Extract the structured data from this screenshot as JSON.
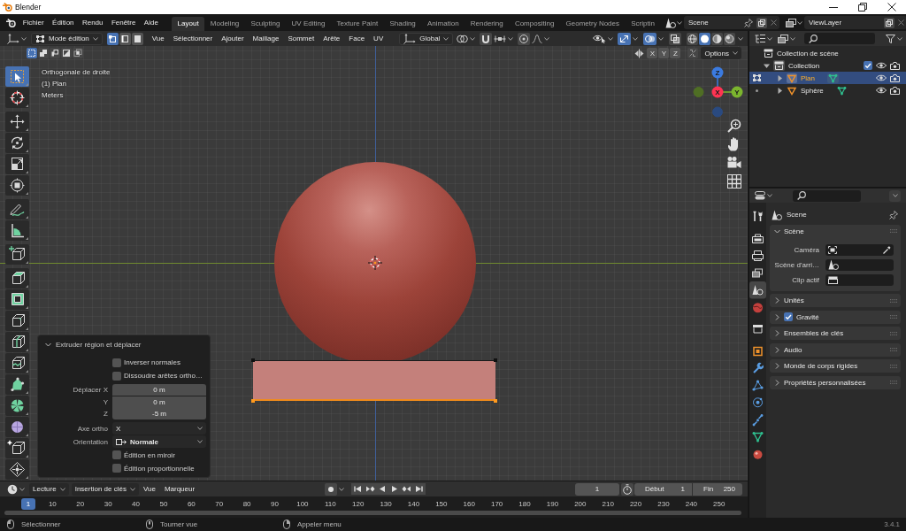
{
  "window": {
    "title": "Blender"
  },
  "top_bar": {
    "menus": [
      "Fichier",
      "Édition",
      "Rendu",
      "Fenêtre",
      "Aide"
    ],
    "workspaces": [
      {
        "label": "Layout",
        "selected": true
      },
      {
        "label": "Modeling",
        "selected": false
      },
      {
        "label": "Sculpting",
        "selected": false
      },
      {
        "label": "UV Editing",
        "selected": false
      },
      {
        "label": "Texture Paint",
        "selected": false
      },
      {
        "label": "Shading",
        "selected": false
      },
      {
        "label": "Animation",
        "selected": false
      },
      {
        "label": "Rendering",
        "selected": false
      },
      {
        "label": "Compositing",
        "selected": false
      },
      {
        "label": "Geometry Nodes",
        "selected": false
      },
      {
        "label": "Scriptin",
        "selected": false
      }
    ],
    "scene": "Scene",
    "view_layer": "ViewLayer"
  },
  "viewport": {
    "header": {
      "mode": "Mode édition",
      "select_modes": [
        {
          "kind": "vertex",
          "selected": true
        },
        {
          "kind": "edge",
          "selected": false
        },
        {
          "kind": "face",
          "selected": false
        }
      ],
      "menus": [
        "Vue",
        "Sélectionner",
        "Ajouter",
        "Maillage",
        "Sommet",
        "Arête",
        "Face",
        "UV"
      ],
      "orientation": "Global",
      "snap": false,
      "proportional": false,
      "toggles": [
        {
          "kind": "gizmo",
          "on": true
        },
        {
          "kind": "overlay",
          "on": true
        },
        {
          "kind": "xray",
          "on": false
        }
      ],
      "shading": [
        {
          "kind": "wireframe",
          "selected": false
        },
        {
          "kind": "solid",
          "selected": true
        },
        {
          "kind": "material",
          "selected": false
        },
        {
          "kind": "rendered",
          "selected": false
        }
      ]
    },
    "tool_header": {
      "box_modes": [
        {
          "kind": "new",
          "selected": true
        },
        {
          "kind": "extend",
          "selected": false
        },
        {
          "kind": "subtract",
          "selected": false
        },
        {
          "kind": "invert",
          "selected": false
        },
        {
          "kind": "intersect",
          "selected": false
        }
      ],
      "mirror_axes": [
        {
          "label": "X",
          "on": false
        },
        {
          "label": "Y",
          "on": false
        },
        {
          "label": "Z",
          "on": false
        }
      ],
      "options": "Options"
    },
    "overlay_text": [
      "Orthogonale de droite",
      "(1) Plan",
      "Meters"
    ],
    "tool_groups": [
      [
        {
          "kind": "select_box",
          "selected": true
        },
        {
          "kind": "cursor",
          "selected": false
        }
      ],
      [
        {
          "kind": "move",
          "selected": false
        },
        {
          "kind": "rotate",
          "selected": false
        },
        {
          "kind": "scale",
          "selected": false
        },
        {
          "kind": "transform",
          "selected": false
        }
      ],
      [
        {
          "kind": "annotate",
          "selected": false
        },
        {
          "kind": "measure",
          "selected": false
        }
      ],
      [
        {
          "kind": "add_cube",
          "selected": false
        }
      ],
      [
        {
          "kind": "extrude",
          "selected": false
        },
        {
          "kind": "inset",
          "selected": false
        },
        {
          "kind": "bevel",
          "selected": false
        },
        {
          "kind": "loop_cut",
          "selected": false
        },
        {
          "kind": "knife",
          "selected": false
        },
        {
          "kind": "poly_build",
          "selected": false
        },
        {
          "kind": "spin",
          "selected": false
        },
        {
          "kind": "smooth",
          "selected": false
        },
        {
          "kind": "randomize",
          "selected": false
        },
        {
          "kind": "shrink",
          "selected": false
        }
      ]
    ],
    "gizmo": {
      "z": "Z",
      "y": "Y",
      "x": "X"
    },
    "operator_panel": {
      "title": "Extruder région et déplacer",
      "expanded": true,
      "rows": [
        {
          "kind": "checkbox",
          "label": "Inverser normales",
          "checked": false
        },
        {
          "kind": "checkbox",
          "label": "Dissoudre arêtes ortho…",
          "checked": false
        },
        {
          "kind": "number",
          "label": "Déplacer X",
          "value": "0 m"
        },
        {
          "kind": "number",
          "label": "Y",
          "value": "0 m"
        },
        {
          "kind": "number",
          "label": "Z",
          "value": "-5 m"
        },
        {
          "kind": "menu",
          "label": "Axe ortho",
          "value": "X"
        },
        {
          "kind": "icon_menu",
          "label": "Orientation",
          "value": "Normale"
        },
        {
          "kind": "checkbox",
          "label": "Édition en miroir",
          "checked": false
        },
        {
          "kind": "checkbox",
          "label": "Édition proportionnelle",
          "checked": false
        }
      ]
    }
  },
  "outliner": {
    "tree": [
      {
        "kind": "scene_collection",
        "label": "Collection de scène",
        "selected": false,
        "children": [
          {
            "kind": "collection",
            "label": "Collection",
            "selected": false,
            "expanded": true,
            "checked": true,
            "visible": true,
            "renderable": true,
            "children": [
              {
                "kind": "mesh",
                "label": "Plan",
                "selected": true,
                "expanded": false,
                "edit_mode": true,
                "visible": true,
                "renderable": true
              },
              {
                "kind": "mesh",
                "label": "Sphère",
                "selected": false,
                "expanded": false,
                "edit_mode": false,
                "visible": true,
                "renderable": true
              }
            ]
          }
        ]
      }
    ]
  },
  "properties": {
    "tab_groups": [
      [
        {
          "kind": "tool",
          "selected": false
        }
      ],
      [
        {
          "kind": "render",
          "selected": false
        },
        {
          "kind": "output",
          "selected": false
        },
        {
          "kind": "view_layer",
          "selected": false
        },
        {
          "kind": "scene",
          "selected": true
        },
        {
          "kind": "world",
          "selected": false
        }
      ],
      [
        {
          "kind": "collection",
          "selected": false
        }
      ],
      [
        {
          "kind": "object",
          "selected": false
        },
        {
          "kind": "modifiers",
          "selected": false
        },
        {
          "kind": "particles",
          "selected": false
        },
        {
          "kind": "physics",
          "selected": false
        },
        {
          "kind": "constraints",
          "selected": false
        },
        {
          "kind": "data",
          "selected": false
        },
        {
          "kind": "material",
          "selected": false
        }
      ]
    ],
    "context": "Scene",
    "panels": [
      {
        "label": "Scène",
        "expanded": true,
        "fields": [
          {
            "kind": "camera",
            "label": "Caméra"
          },
          {
            "kind": "scene",
            "label": "Scène d'arri…"
          },
          {
            "kind": "clip",
            "label": "Clip actif"
          }
        ]
      },
      {
        "label": "Unités",
        "expanded": false
      },
      {
        "label": "Gravité",
        "expanded": false,
        "checked": true
      },
      {
        "label": "Ensembles de clés",
        "expanded": false
      },
      {
        "label": "Audio",
        "expanded": false
      },
      {
        "label": "Monde de corps rigides",
        "expanded": false
      },
      {
        "label": "Propriétés personnalisées",
        "expanded": false
      }
    ]
  },
  "timeline": {
    "menus": [
      {
        "kind": "dropdown",
        "label": "Lecture"
      },
      {
        "kind": "dropdown",
        "label": "Insertion de clés"
      },
      {
        "kind": "menu",
        "label": "Vue"
      },
      {
        "kind": "menu",
        "label": "Marqueur"
      }
    ],
    "auto_keying": false,
    "current_frame": "1",
    "start_label": "Début",
    "start": "1",
    "end_label": "Fin",
    "end": "250",
    "playhead": "1",
    "ruler": [
      "10",
      "20",
      "30",
      "40",
      "50",
      "60",
      "70",
      "80",
      "90",
      "100",
      "110",
      "120",
      "130",
      "140",
      "150",
      "160",
      "170",
      "180",
      "190",
      "200",
      "210",
      "220",
      "230",
      "240",
      "250"
    ]
  },
  "status_bar": {
    "hints": [
      {
        "kind": "left",
        "label": "Sélectionner"
      },
      {
        "kind": "middle",
        "label": "Tourner vue"
      },
      {
        "kind": "right",
        "label": "Appeler menu"
      }
    ],
    "version": "3.4.1"
  }
}
